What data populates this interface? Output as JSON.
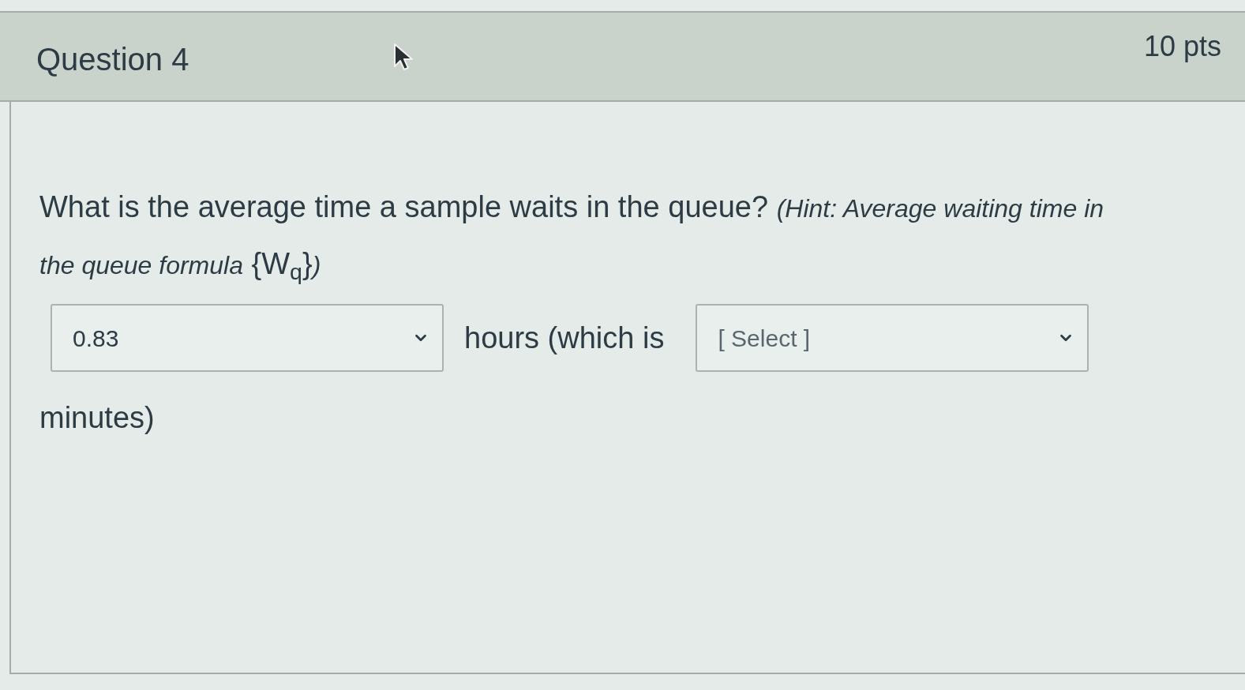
{
  "question": {
    "title": "Question 4",
    "points": "10 pts",
    "text": "What is the average time a sample waits in the queue? *(Hint: Average waiting time in the queue formula* {W$_{q}$}*)*",
    "answer": [
      {
        "kind": "dropdown",
        "value": "0.83"
      },
      {
        "kind": "text",
        "text": "hours (which is"
      },
      {
        "kind": "dropdown",
        "placeholder": "[ Select ]"
      },
      {
        "kind": "text",
        "text": "minutes)"
      }
    ]
  }
}
